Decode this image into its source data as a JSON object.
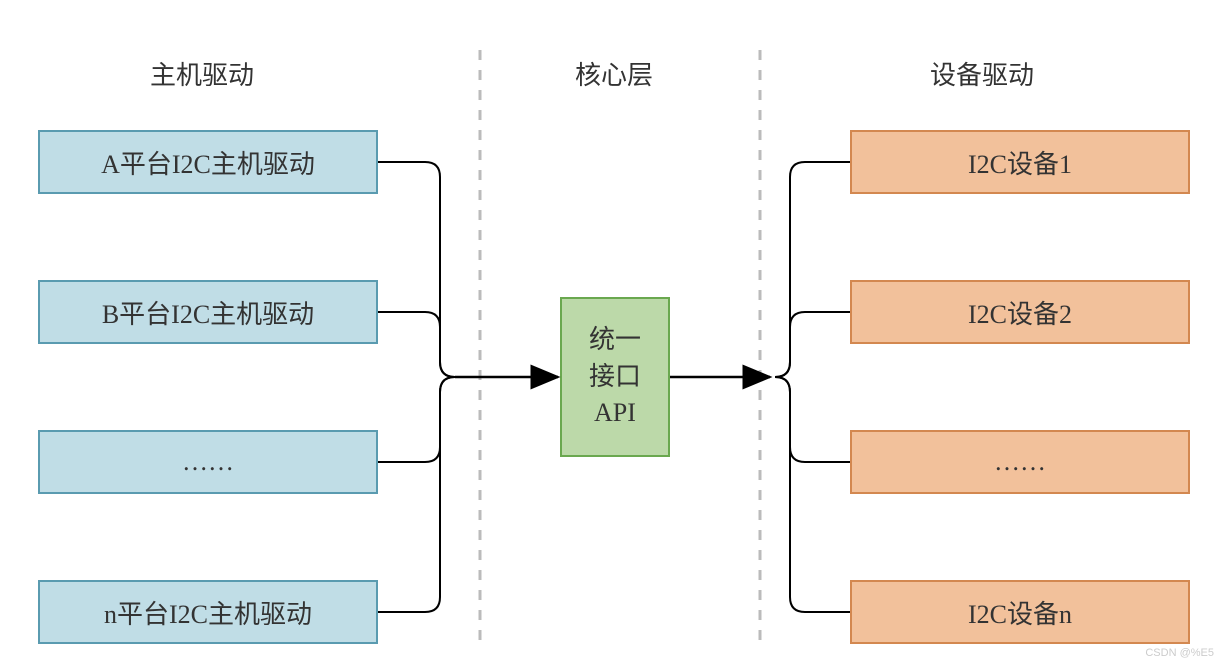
{
  "columns": {
    "left": {
      "title": "主机驱动"
    },
    "center": {
      "title": "核心层"
    },
    "right": {
      "title": "设备驱动"
    }
  },
  "left_boxes": {
    "b1": "A平台I2C主机驱动",
    "b2": "B平台I2C主机驱动",
    "b3": "……",
    "b4": "n平台I2C主机驱动"
  },
  "center_box": {
    "line1": "统一",
    "line2": "接口",
    "line3": "API"
  },
  "right_boxes": {
    "b1": "I2C设备1",
    "b2": "I2C设备2",
    "b3": "……",
    "b4": "I2C设备n"
  },
  "watermark": "CSDN @%E5"
}
